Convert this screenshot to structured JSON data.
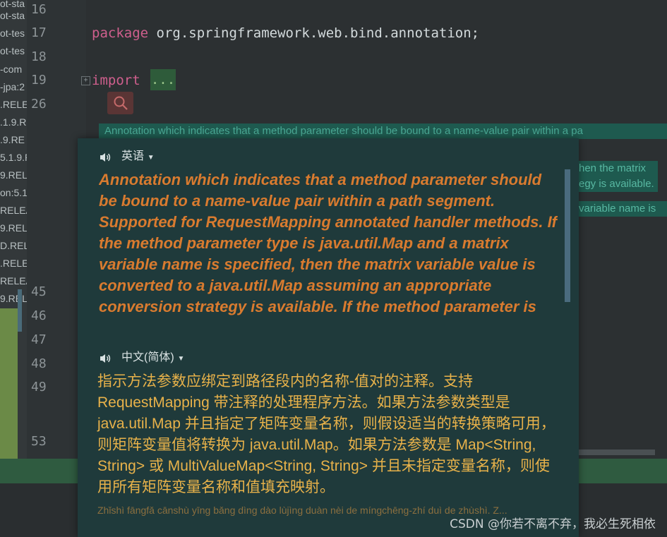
{
  "tree": {
    "items": [
      "ot-sta",
      "ot-sta",
      "ot-tes",
      "ot-tes",
      "-com",
      "-jpa:2",
      ".RELE",
      ".1.9.R",
      ".9.RE",
      "5.1.9.R",
      "9.REL",
      "on:5.1",
      "RELEA",
      "9.REL",
      "D.REL",
      ".RELE",
      "RELEA",
      "9.REL"
    ]
  },
  "gutter": {
    "lines": [
      "16",
      "17",
      "18",
      "19",
      "26",
      "45",
      "46",
      "47",
      "48",
      "49",
      "53"
    ]
  },
  "code": {
    "package_kw": "package",
    "package_name": " org.springframework.web.bind.annotation;",
    "import_kw": "import",
    "import_ellipsis": "...",
    "search_icon": "search-icon",
    "doc_line1": "Annotation which indicates that a method parameter should be bound to a name-value pair within a pa",
    "doc_right1a": "hen the matrix",
    "doc_right1b": "egy is available.",
    "doc_right2": "variable name is"
  },
  "popup": {
    "source_lang": "英语",
    "target_lang": "中文(简体)",
    "source_text": "Annotation which indicates that a method parameter should be bound to a name-value pair within a path segment. Supported for RequestMapping annotated handler methods. If the method parameter type is java.util.Map and a matrix variable name is specified, then the matrix variable value is converted to a java.util.Map assuming an appropriate conversion strategy is available. If the method parameter is",
    "translated_text": "指示方法参数应绑定到路径段内的名称-值对的注释。支持 RequestMapping 带注释的处理程序方法。如果方法参数类型是 java.util.Map 并且指定了矩阵变量名称，则假设适当的转换策略可用，则矩阵变量值将转换为 java.util.Map。如果方法参数是 Map<String, String> 或 MultiValueMap<String, String> 并且未指定变量名称，则使用所有矩阵变量名称和值填充映射。",
    "pinyin": "Zhǐshì fāngfǎ cānshù yīng bǎng dìng dào lùjìng duàn nèi de míngchēng-zhí duì de zhùshì. Z...",
    "colors": {
      "source": "#d97b2f",
      "target": "#e8b24a",
      "background": "#1f3a3b"
    }
  },
  "watermark": "CSDN @你若不离不弃，我必生死相依"
}
